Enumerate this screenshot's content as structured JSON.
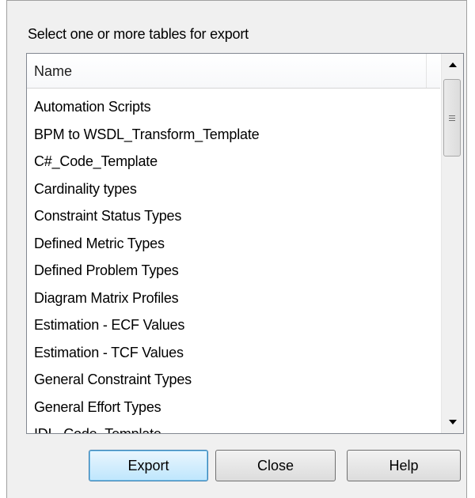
{
  "dialog": {
    "group_label": "Select one or more tables for export",
    "list": {
      "column_header": "Name",
      "items": [
        "Automation Scripts",
        "BPM to WSDL_Transform_Template",
        "C#_Code_Template",
        "Cardinality types",
        "Constraint Status Types",
        "Defined Metric Types",
        "Defined Problem Types",
        "Diagram Matrix Profiles",
        "Estimation - ECF Values",
        "Estimation - TCF Values",
        "General Constraint Types",
        "General Effort Types",
        "IDL_Code_Template"
      ]
    },
    "buttons": {
      "export": "Export",
      "close": "Close",
      "help": "Help"
    }
  },
  "icons": {
    "scroll_up": "scroll-up-arrow-icon",
    "scroll_down": "scroll-down-arrow-icon",
    "thumb_grip": "scrollbar-grip-icon"
  },
  "colors": {
    "dialog_bg": "#f0f0f0",
    "default_button_border": "#3c7fb1",
    "list_border": "#828790"
  }
}
